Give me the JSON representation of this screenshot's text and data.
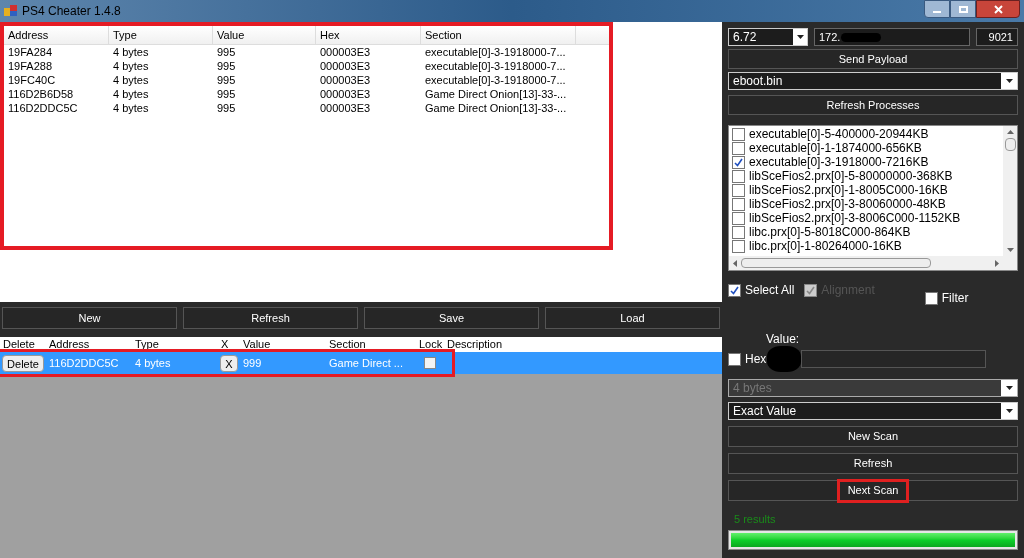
{
  "window": {
    "title": "PS4 Cheater 1.4.8"
  },
  "results_table": {
    "highlighted": true,
    "columns": [
      "Address",
      "Type",
      "Value",
      "Hex",
      "Section"
    ],
    "rows": [
      [
        "19FA284",
        "4 bytes",
        "995",
        "000003E3",
        "executable[0]-3-1918000-7..."
      ],
      [
        "19FA288",
        "4 bytes",
        "995",
        "000003E3",
        "executable[0]-3-1918000-7..."
      ],
      [
        "19FC40C",
        "4 bytes",
        "995",
        "000003E3",
        "executable[0]-3-1918000-7..."
      ],
      [
        "116D2B6D58",
        "4 bytes",
        "995",
        "000003E3",
        "Game Direct Onion[13]-33-..."
      ],
      [
        "116D2DDC5C",
        "4 bytes",
        "995",
        "000003E3",
        "Game Direct Onion[13]-33-..."
      ]
    ]
  },
  "list_buttons": [
    "New",
    "Refresh",
    "Save",
    "Load"
  ],
  "saved_table": {
    "columns": [
      "Delete",
      "Address",
      "Type",
      "X",
      "Value",
      "Section",
      "Lock",
      "Description"
    ],
    "rows": [
      {
        "selected": true,
        "highlighted": true,
        "delete": "Delete",
        "address": "116D2DDC5C",
        "type": "4 bytes",
        "x": "X",
        "value": "999",
        "section": "Game Direct ...",
        "locked": false,
        "description": ""
      }
    ]
  },
  "connection": {
    "firmware": "6.72",
    "ip": "172.",
    "ip_redacted": true,
    "port": "9021"
  },
  "send_payload": "Send Payload",
  "process": "eboot.bin",
  "refresh_processes": "Refresh Processes",
  "sections": [
    {
      "label": "executable[0]-5-400000-20944KB",
      "checked": false
    },
    {
      "label": "executable[0]-1-1874000-656KB",
      "checked": false
    },
    {
      "label": "executable[0]-3-1918000-7216KB",
      "checked": true
    },
    {
      "label": "libSceFios2.prx[0]-5-80000000-368KB",
      "checked": false
    },
    {
      "label": "libSceFios2.prx[0]-1-8005C000-16KB",
      "checked": false
    },
    {
      "label": "libSceFios2.prx[0]-3-80060000-48KB",
      "checked": false
    },
    {
      "label": "libSceFios2.prx[0]-3-8006C000-1152KB",
      "checked": false
    },
    {
      "label": "libc.prx[0]-5-8018C000-864KB",
      "checked": false
    },
    {
      "label": "libc.prx[0]-1-80264000-16KB",
      "checked": false
    }
  ],
  "select_all": {
    "label": "Select All",
    "checked": true,
    "disabled": false
  },
  "alignment": {
    "label": "Alignment",
    "checked": true,
    "disabled": true
  },
  "filter": {
    "label": "Filter",
    "checked": false,
    "disabled": false
  },
  "value_label": "Value:",
  "hex": {
    "label": "Hex",
    "checked": false,
    "disabled": false
  },
  "value_redacted": true,
  "value_type": {
    "value": "4 bytes",
    "disabled": true
  },
  "compare_type": {
    "value": "Exact Value",
    "disabled": false
  },
  "scan_buttons": [
    {
      "label": "New Scan",
      "highlighted": false
    },
    {
      "label": "Refresh",
      "highlighted": false
    },
    {
      "label": "Next Scan",
      "highlighted": true
    }
  ],
  "results_count": "5 results",
  "progress": {
    "level": 1
  }
}
